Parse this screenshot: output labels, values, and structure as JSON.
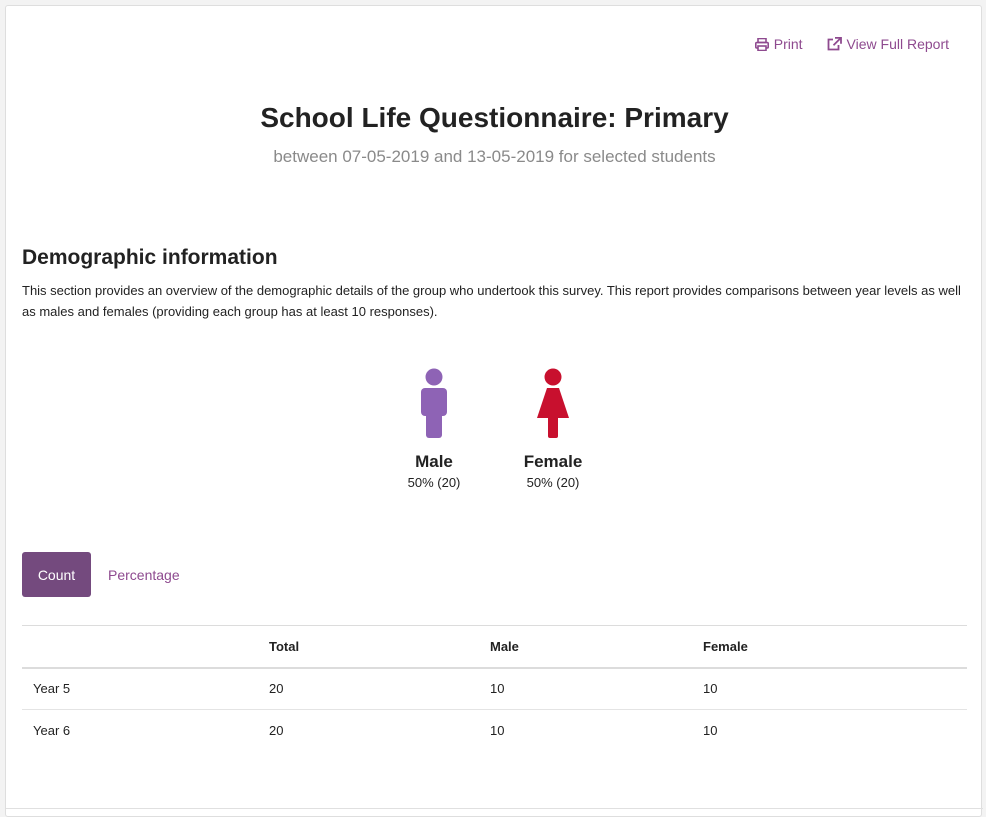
{
  "actions": {
    "print_label": "Print",
    "view_full_report_label": "View Full Report"
  },
  "header": {
    "title": "School Life Questionnaire: Primary",
    "subtitle": "between 07-05-2019 and 13-05-2019 for selected students"
  },
  "section": {
    "heading": "Demographic information",
    "description": "This section provides an overview of the demographic details of the group who undertook this survey. This report provides comparisons between year levels as well as males and females (providing each group has at least 10 responses)."
  },
  "genders": [
    {
      "label": "Male",
      "value": "50% (20)",
      "icon": "male-person-icon",
      "color": "#8e63b5"
    },
    {
      "label": "Female",
      "value": "50% (20)",
      "icon": "female-person-icon",
      "color": "#c8102e"
    }
  ],
  "toggle": {
    "count_label": "Count",
    "percentage_label": "Percentage",
    "active_color": "#744a7e"
  },
  "table": {
    "headers": [
      "",
      "Total",
      "Male",
      "Female"
    ],
    "rows": [
      [
        "Year 5",
        "20",
        "10",
        "10"
      ],
      [
        "Year 6",
        "20",
        "10",
        "10"
      ]
    ]
  }
}
